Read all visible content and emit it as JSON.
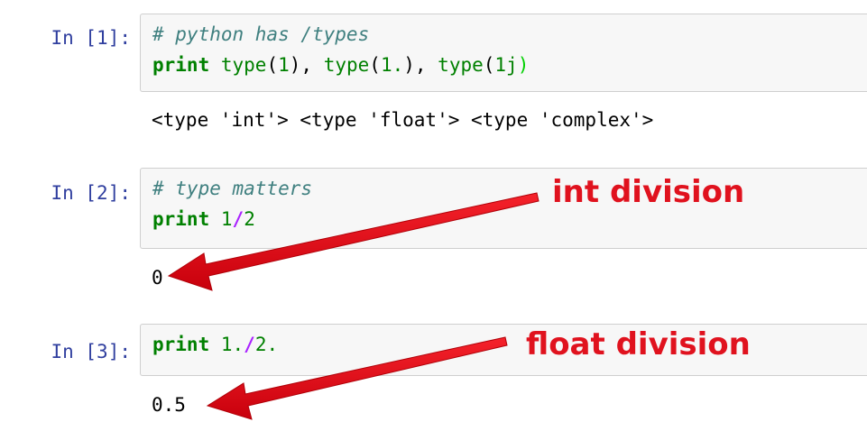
{
  "cells": [
    {
      "prompt": "In [1]:",
      "code_lines": [
        [
          {
            "text": "# python has /types",
            "class": "cm"
          }
        ],
        [
          {
            "text": "print",
            "class": "kw"
          },
          {
            "text": " ",
            "class": "pn"
          },
          {
            "text": "type",
            "class": "nb"
          },
          {
            "text": "(",
            "class": "pn"
          },
          {
            "text": "1",
            "class": "mi"
          },
          {
            "text": "), ",
            "class": "pn"
          },
          {
            "text": "type",
            "class": "nb"
          },
          {
            "text": "(",
            "class": "pn"
          },
          {
            "text": "1.",
            "class": "mi"
          },
          {
            "text": "), ",
            "class": "pn"
          },
          {
            "text": "type",
            "class": "nb"
          },
          {
            "text": "(",
            "class": "pn"
          },
          {
            "text": "1j",
            "class": "mi"
          },
          {
            "text": ")",
            "class": "pg"
          }
        ]
      ],
      "output": "<type 'int'> <type 'float'> <type 'complex'>"
    },
    {
      "prompt": "In [2]:",
      "code_lines": [
        [
          {
            "text": "# type matters",
            "class": "cm"
          }
        ],
        [
          {
            "text": "print",
            "class": "kw"
          },
          {
            "text": " ",
            "class": "pn"
          },
          {
            "text": "1",
            "class": "mi"
          },
          {
            "text": "/",
            "class": "op"
          },
          {
            "text": "2",
            "class": "mi"
          }
        ]
      ],
      "output": "0"
    },
    {
      "prompt": "In [3]:",
      "code_lines": [
        [
          {
            "text": "print",
            "class": "kw"
          },
          {
            "text": " ",
            "class": "pn"
          },
          {
            "text": "1.",
            "class": "mi"
          },
          {
            "text": "/",
            "class": "op"
          },
          {
            "text": "2.",
            "class": "mi"
          }
        ]
      ],
      "output": "0.5"
    }
  ],
  "annotations": {
    "int_division": "int division",
    "float_division": "float division"
  },
  "colors": {
    "annotation": "#e0121e",
    "prompt": "#303f9f",
    "comment": "#408080",
    "keyword": "#008000",
    "operator": "#aa22ff"
  }
}
